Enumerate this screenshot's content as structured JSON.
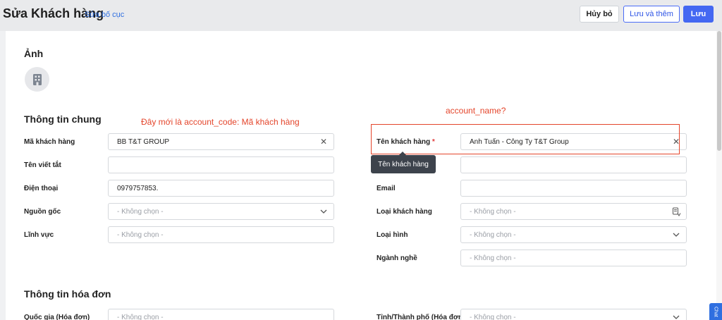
{
  "header": {
    "title": "Sửa Khách hàng",
    "layout_link": "Sửa bố cục",
    "cancel_label": "Hủy bỏ",
    "save_add_label": "Lưu và thêm",
    "save_label": "Lưu"
  },
  "sections": {
    "photo": "Ảnh",
    "general": "Thông tin chung",
    "invoice": "Thông tin hóa đơn"
  },
  "annotations": {
    "account_code_note": "Đây mới là account_code: Mã khách hàng",
    "account_name_note": "account_name?",
    "tooltip": "Tên khách hàng"
  },
  "left_fields": [
    {
      "label": "Mã khách hàng",
      "value": "BB T&T GROUP",
      "icon": "clear-icon"
    },
    {
      "label": "Tên viết tắt",
      "value": ""
    },
    {
      "label": "Điện thoại",
      "value": "0979757853."
    },
    {
      "label": "Nguồn gốc",
      "placeholder": "- Không chọn -",
      "icon": "chevron-down-icon"
    },
    {
      "label": "Lĩnh vực",
      "placeholder": "- Không chọn -"
    }
  ],
  "right_fields": [
    {
      "label": "Tên khách hàng",
      "required": "*",
      "value": "Anh Tuấn - Công Ty T&T Group",
      "icon": "clear-icon"
    },
    {
      "label": "",
      "value": ""
    },
    {
      "label": "Email",
      "value": ""
    },
    {
      "label": "Loại khách hàng",
      "placeholder": "- Không chọn -",
      "icon": "picker-icon"
    },
    {
      "label": "Loại hình",
      "placeholder": "- Không chọn -",
      "icon": "chevron-down-icon"
    },
    {
      "label": "Ngành nghề",
      "placeholder": "- Không chọn -"
    }
  ],
  "invoice_fields": [
    {
      "label": "Quốc gia (Hóa đơn)",
      "placeholder": "- Không chọn -"
    },
    {
      "label": "Tỉnh/Thành phố (Hóa đơn)",
      "placeholder": "- Không chọn -",
      "icon": "chevron-down-icon"
    }
  ],
  "chat_label": "Chat",
  "colors": {
    "accent": "#4468f2",
    "annotation": "#e4452b"
  }
}
